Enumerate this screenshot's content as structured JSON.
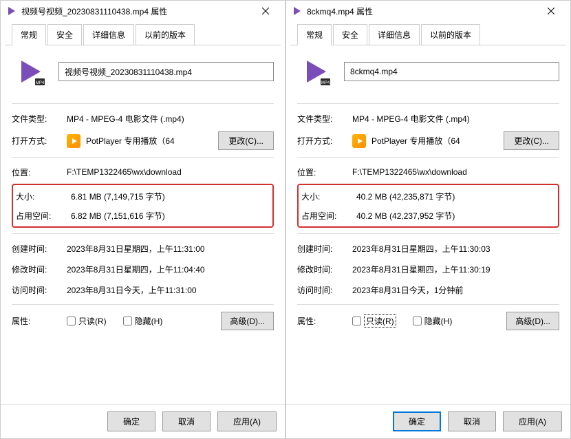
{
  "left": {
    "title": "视频号视频_20230831110438.mp4 属性",
    "tabs": [
      "常规",
      "安全",
      "详细信息",
      "以前的版本"
    ],
    "filename": "视频号视频_20230831110438.mp4",
    "filetype_label": "文件类型:",
    "filetype_value": "MP4 - MPEG-4 电影文件 (.mp4)",
    "openwith_label": "打开方式:",
    "openwith_value": "PotPlayer 专用播放（64",
    "change_btn": "更改(C)...",
    "location_label": "位置:",
    "location_value": "F:\\TEMP1322465\\wx\\download",
    "size_label": "大小:",
    "size_value": "6.81 MB (7,149,715 字节)",
    "disk_label": "占用空间:",
    "disk_value": "6.82 MB (7,151,616 字节)",
    "created_label": "创建时间:",
    "created_value": "2023年8月31日星期四，上午11:31:00",
    "modified_label": "修改时间:",
    "modified_value": "2023年8月31日星期四，上午11:04:40",
    "accessed_label": "访问时间:",
    "accessed_value": "2023年8月31日今天，上午11:31:00",
    "attr_label": "属性:",
    "readonly_label": "只读(R)",
    "hidden_label": "隐藏(H)",
    "advanced_btn": "高级(D)...",
    "ok_btn": "确定",
    "cancel_btn": "取消",
    "apply_btn": "应用(A)"
  },
  "right": {
    "title": "8ckmq4.mp4 属性",
    "tabs": [
      "常规",
      "安全",
      "详细信息",
      "以前的版本"
    ],
    "filename": "8ckmq4.mp4",
    "filetype_label": "文件类型:",
    "filetype_value": "MP4 - MPEG-4 电影文件 (.mp4)",
    "openwith_label": "打开方式:",
    "openwith_value": "PotPlayer 专用播放（64",
    "change_btn": "更改(C)...",
    "location_label": "位置:",
    "location_value": "F:\\TEMP1322465\\wx\\download",
    "size_label": "大小:",
    "size_value": "40.2 MB (42,235,871 字节)",
    "disk_label": "占用空间:",
    "disk_value": "40.2 MB (42,237,952 字节)",
    "created_label": "创建时间:",
    "created_value": "2023年8月31日星期四，上午11:30:03",
    "modified_label": "修改时间:",
    "modified_value": "2023年8月31日星期四，上午11:30:19",
    "accessed_label": "访问时间:",
    "accessed_value": "2023年8月31日今天，1分钟前",
    "attr_label": "属性:",
    "readonly_label": "只读(R)",
    "hidden_label": "隐藏(H)",
    "advanced_btn": "高级(D)...",
    "ok_btn": "确定",
    "cancel_btn": "取消",
    "apply_btn": "应用(A)"
  }
}
